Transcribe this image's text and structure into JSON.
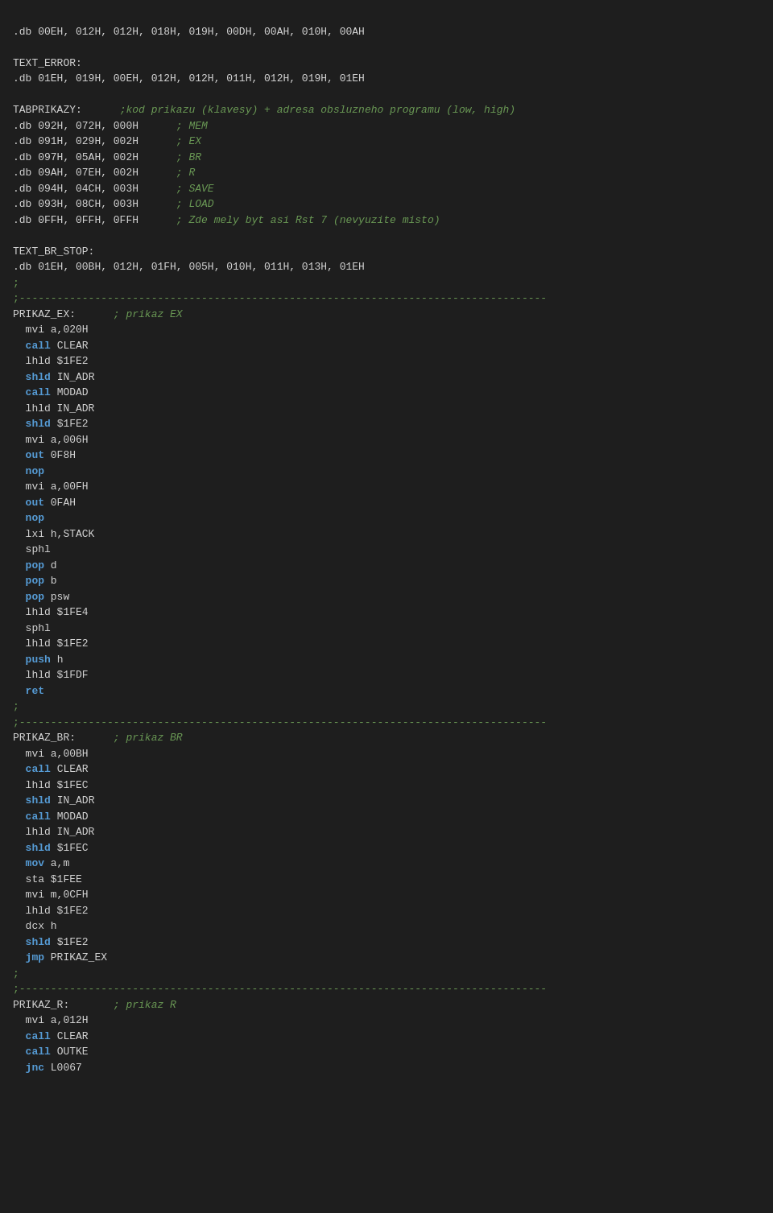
{
  "code": {
    "lines": [
      {
        "type": "normal",
        "text": ".db 00EH, 012H, 012H, 018H, 019H, 00DH, 00AH, 010H, 00AH"
      },
      {
        "type": "normal",
        "text": ""
      },
      {
        "type": "label",
        "text": "TEXT_ERROR:"
      },
      {
        "type": "normal",
        "text": ".db 01EH, 019H, 00EH, 012H, 012H, 011H, 012H, 019H, 01EH"
      },
      {
        "type": "normal",
        "text": ""
      },
      {
        "type": "mixed_tabprikazy",
        "parts": [
          {
            "t": "label",
            "v": "TABPRIKAZY:"
          },
          {
            "t": "tab",
            "v": "\t"
          },
          {
            "t": "comment",
            "v": ";kod prikazu (klavesy) + adresa obsluzneho programu (low, high)"
          }
        ]
      },
      {
        "type": "mixed_db_comment",
        "parts": [
          {
            "t": "normal",
            "v": ".db 092H, 072H, 000H"
          },
          {
            "t": "tab",
            "v": "\t\t"
          },
          {
            "t": "comment",
            "v": "; MEM"
          }
        ]
      },
      {
        "type": "mixed_db_comment",
        "parts": [
          {
            "t": "normal",
            "v": ".db 091H, 029H, 002H"
          },
          {
            "t": "tab",
            "v": "\t\t"
          },
          {
            "t": "comment",
            "v": "; EX"
          }
        ]
      },
      {
        "type": "mixed_db_comment",
        "parts": [
          {
            "t": "normal",
            "v": ".db 097H, 05AH, 002H"
          },
          {
            "t": "tab",
            "v": "\t\t"
          },
          {
            "t": "comment",
            "v": "; BR"
          }
        ]
      },
      {
        "type": "mixed_db_comment",
        "parts": [
          {
            "t": "normal",
            "v": ".db 09AH, 07EH, 002H"
          },
          {
            "t": "tab",
            "v": "\t\t"
          },
          {
            "t": "comment",
            "v": "; R"
          }
        ]
      },
      {
        "type": "mixed_db_comment",
        "parts": [
          {
            "t": "normal",
            "v": ".db 094H, 04CH, 003H"
          },
          {
            "t": "tab",
            "v": "\t\t"
          },
          {
            "t": "comment",
            "v": "; SAVE"
          }
        ]
      },
      {
        "type": "mixed_db_comment",
        "parts": [
          {
            "t": "normal",
            "v": ".db 093H, 08CH, 003H"
          },
          {
            "t": "tab",
            "v": "\t\t"
          },
          {
            "t": "comment",
            "v": "; LOAD"
          }
        ]
      },
      {
        "type": "mixed_db_comment",
        "parts": [
          {
            "t": "normal",
            "v": ".db 0FFH, 0FFH, 0FFH"
          },
          {
            "t": "tab",
            "v": "\t\t"
          },
          {
            "t": "comment",
            "v": "; Zde mely byt asi Rst 7 (nevyuzite misto)"
          }
        ]
      },
      {
        "type": "normal",
        "text": ""
      },
      {
        "type": "label",
        "text": "TEXT_BR_STOP:"
      },
      {
        "type": "normal",
        "text": ".db 01EH, 00BH, 012H, 01FH, 005H, 010H, 011H, 013H, 01EH"
      },
      {
        "type": "separator",
        "text": ";"
      },
      {
        "type": "separator_line",
        "text": ";------------------------------------------------------------------------------------"
      },
      {
        "type": "mixed_prikaz",
        "label": "PRIKAZ_EX:",
        "comment": "; prikaz EX"
      },
      {
        "type": "indent_normal",
        "text": "  mvi a,020H"
      },
      {
        "type": "indent_kw_normal",
        "kw": "call",
        "rest": " CLEAR"
      },
      {
        "type": "indent_normal",
        "text": "  lhld $1FE2"
      },
      {
        "type": "indent_kw_normal",
        "kw": "shld",
        "rest": " IN_ADR"
      },
      {
        "type": "indent_kw_normal",
        "kw": "call",
        "rest": " MODAD"
      },
      {
        "type": "indent_normal",
        "text": "  lhld IN_ADR"
      },
      {
        "type": "indent_kw_normal",
        "kw": "shld",
        "rest": " $1FE2"
      },
      {
        "type": "indent_normal",
        "text": "  mvi a,006H"
      },
      {
        "type": "indent_kw_normal",
        "kw": "out",
        "rest": " 0F8H"
      },
      {
        "type": "indent_kw_normal",
        "kw": "nop",
        "rest": ""
      },
      {
        "type": "indent_normal",
        "text": "  mvi a,00FH"
      },
      {
        "type": "indent_kw_normal",
        "kw": "out",
        "rest": " 0FAH"
      },
      {
        "type": "indent_kw_normal",
        "kw": "nop",
        "rest": ""
      },
      {
        "type": "indent_normal",
        "text": "  lxi h,STACK"
      },
      {
        "type": "indent_normal",
        "text": "  sphl"
      },
      {
        "type": "indent_kw_normal",
        "kw": "pop",
        "rest": " d"
      },
      {
        "type": "indent_kw_normal",
        "kw": "pop",
        "rest": " b"
      },
      {
        "type": "indent_kw_normal",
        "kw": "pop",
        "rest": " psw"
      },
      {
        "type": "indent_normal",
        "text": "  lhld $1FE4"
      },
      {
        "type": "indent_normal",
        "text": "  sphl"
      },
      {
        "type": "indent_normal",
        "text": "  lhld $1FE2"
      },
      {
        "type": "indent_kw_normal",
        "kw": "push",
        "rest": " h"
      },
      {
        "type": "indent_normal",
        "text": "  lhld $1FDF"
      },
      {
        "type": "indent_kw_normal",
        "kw": "ret",
        "rest": ""
      },
      {
        "type": "separator",
        "text": ";"
      },
      {
        "type": "separator_line",
        "text": ";------------------------------------------------------------------------------------"
      },
      {
        "type": "mixed_prikaz",
        "label": "PRIKAZ_BR:",
        "comment": "; prikaz BR"
      },
      {
        "type": "indent_normal",
        "text": "  mvi a,00BH"
      },
      {
        "type": "indent_kw_normal",
        "kw": "call",
        "rest": " CLEAR"
      },
      {
        "type": "indent_normal",
        "text": "  lhld $1FEC"
      },
      {
        "type": "indent_kw_normal",
        "kw": "shld",
        "rest": " IN_ADR"
      },
      {
        "type": "indent_kw_normal",
        "kw": "call",
        "rest": " MODAD"
      },
      {
        "type": "indent_normal",
        "text": "  lhld IN_ADR"
      },
      {
        "type": "indent_kw_normal",
        "kw": "shld",
        "rest": " $1FEC"
      },
      {
        "type": "indent_kw_normal",
        "kw": "mov",
        "rest": " a,m"
      },
      {
        "type": "indent_normal",
        "text": "  sta $1FEE"
      },
      {
        "type": "indent_normal",
        "text": "  mvi m,0CFH"
      },
      {
        "type": "indent_normal",
        "text": "  lhld $1FE2"
      },
      {
        "type": "indent_normal",
        "text": "  dcx h"
      },
      {
        "type": "indent_kw_normal",
        "kw": "shld",
        "rest": " $1FE2"
      },
      {
        "type": "indent_kw_normal",
        "kw": "jmp",
        "rest": " PRIKAZ_EX"
      },
      {
        "type": "separator",
        "text": ";"
      },
      {
        "type": "separator_line",
        "text": ";------------------------------------------------------------------------------------"
      },
      {
        "type": "mixed_prikaz",
        "label": "PRIKAZ_R:",
        "comment": "; prikaz R"
      },
      {
        "type": "indent_normal",
        "text": "  mvi a,012H"
      },
      {
        "type": "indent_kw_normal",
        "kw": "call",
        "rest": " CLEAR"
      },
      {
        "type": "indent_kw_normal",
        "kw": "call",
        "rest": " OUTKE"
      },
      {
        "type": "indent_kw_normal",
        "kw": "jnc",
        "rest": " L0067"
      }
    ]
  }
}
